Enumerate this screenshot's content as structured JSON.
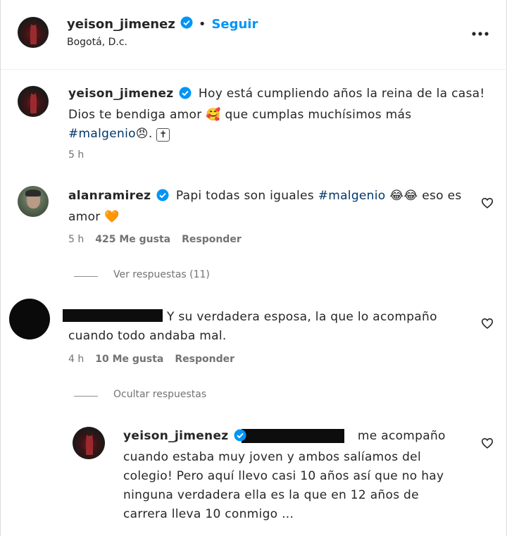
{
  "header": {
    "username": "yeison_jimenez",
    "separator": "•",
    "follow_label": "Seguir",
    "location": "Bogotá, D.c.",
    "more_icon": "more-horizontal-icon"
  },
  "caption": {
    "username": "yeison_jimenez",
    "text_1": "Hoy está cumpliendo años la reina de la casa!",
    "text_2": "Dios te bendiga amor",
    "emoji_1": "🥰",
    "text_3": "que cumplas muchísimos más",
    "hashtag": "#malgenio",
    "emoji_2": "😠",
    "text_4": ".",
    "emoji_3": "✝",
    "time": "5 h"
  },
  "comments": [
    {
      "username": "alanramirez",
      "text_1": "Papi todas son iguales",
      "hashtag": "#malgenio",
      "emoji_1": "😂😂",
      "text_2": "eso es",
      "text_3": "amor",
      "emoji_2": "🧡",
      "time": "5 h",
      "likes": "425 Me gusta",
      "reply_label": "Responder",
      "view_replies": "Ver respuestas (11)"
    },
    {
      "username_hidden": true,
      "text_1": "Y su verdadera esposa, la que lo acompaño",
      "text_2": "cuando todo andaba mal.",
      "time": "4 h",
      "likes": "10 Me gusta",
      "reply_label": "Responder",
      "hide_replies": "Ocultar respuestas"
    }
  ],
  "reply": {
    "username": "yeison_jimenez",
    "line_1": "me acompaño",
    "line_2": "cuando estaba muy joven y ambos salíamos del",
    "line_3": "colegio! Pero aquí llevo casi 10 años así que no hay",
    "line_4": "ninguna verdadera ella es la que en 12 años de",
    "line_5": "carrera lleva 10 conmigo ..."
  },
  "colors": {
    "verified": "#0095f6",
    "follow": "#0095f6",
    "hashtag": "#00376b",
    "heart_emoji": "#f4731f"
  }
}
